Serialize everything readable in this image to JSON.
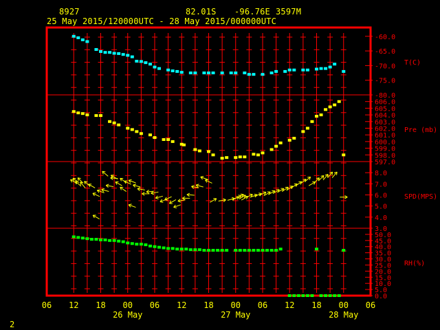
{
  "header": {
    "station": "8927",
    "lat": "82.01S",
    "lon": "-96.76E",
    "elev": "3597M",
    "period": "25 May 2015/120000UTC - 28 May 2015/000000UTC",
    "footer_number": "2"
  },
  "colors": {
    "frame": "#ff0000",
    "temperature": "#00ffff",
    "pressure": "#ffff00",
    "wind": "#ffff00",
    "humidity": "#00ff00",
    "axis_text": "#ffff00",
    "panel_labels": "#ff0000"
  },
  "chart_data": {
    "type": "scatter",
    "x_unit": "hours after 25 May 06 UTC",
    "xlim": [
      0,
      72
    ],
    "x_tick_labels": [
      "06",
      "12",
      "18",
      "00",
      "06",
      "12",
      "18",
      "00",
      "06",
      "12",
      "18",
      "00",
      "06"
    ],
    "date_labels": [
      {
        "label": "26 May",
        "x": 18
      },
      {
        "label": "27 May",
        "x": 42
      },
      {
        "label": "28 May",
        "x": 66
      }
    ],
    "panels": [
      {
        "key": "temp",
        "label": "T(C)",
        "ylim": [
          -80,
          -57
        ],
        "y_ticks": [
          -60,
          -65,
          -70,
          -75,
          -80
        ],
        "y_tick_labels": [
          "-60.0",
          "-65.0",
          "-70.0",
          "-75.0",
          "-80.0"
        ],
        "x": [
          6,
          7,
          8,
          9,
          11,
          12,
          13,
          14,
          15,
          16,
          17,
          18,
          19,
          20,
          21,
          22,
          23,
          24,
          25,
          27,
          28,
          29,
          30,
          32,
          33,
          35,
          36,
          37,
          39,
          41,
          42,
          44,
          45,
          46,
          48,
          50,
          51,
          53,
          54,
          55,
          57,
          58,
          60,
          61,
          62,
          63,
          64,
          66
        ],
        "values": [
          -60.0,
          -60.5,
          -61.2,
          -61.8,
          -64.5,
          -65.2,
          -65.5,
          -65.5,
          -65.8,
          -65.9,
          -66.2,
          -66.5,
          -67.0,
          -68.5,
          -68.6,
          -69.0,
          -69.5,
          -70.5,
          -71.0,
          -71.5,
          -71.8,
          -72.0,
          -72.3,
          -72.5,
          -72.5,
          -72.5,
          -72.5,
          -72.5,
          -72.5,
          -72.5,
          -72.5,
          -72.5,
          -73.0,
          -73.0,
          -73.0,
          -72.5,
          -72.0,
          -72.0,
          -71.5,
          -71.5,
          -71.5,
          -71.5,
          -71.2,
          -71.0,
          -71.0,
          -70.5,
          -69.5,
          -72.0
        ]
      },
      {
        "key": "pres",
        "label": "Pre (mb)",
        "ylim": [
          597,
          607
        ],
        "y_ticks": [
          606,
          605,
          604,
          603,
          602,
          601,
          600,
          599,
          598,
          597
        ],
        "y_tick_labels": [
          "606.0",
          "605.0",
          "604.0",
          "603.0",
          "602.0",
          "601.0",
          "600.0",
          "599.0",
          "598.0",
          "597.0"
        ],
        "x": [
          6,
          7,
          8,
          9,
          11,
          12,
          14,
          15,
          16,
          18,
          19,
          20,
          21,
          23,
          24,
          26,
          27,
          28,
          30,
          30.5,
          33,
          34,
          36,
          37,
          39,
          40,
          42,
          43,
          44,
          46,
          47,
          48,
          50,
          51,
          52,
          54,
          55,
          57,
          58,
          59,
          60,
          61,
          62,
          63,
          64,
          65,
          66
        ],
        "values": [
          604.5,
          604.3,
          604.2,
          604.0,
          603.9,
          603.9,
          603.0,
          602.8,
          602.5,
          602.0,
          601.8,
          601.5,
          601.2,
          601.0,
          600.6,
          600.3,
          600.3,
          600.0,
          599.6,
          599.5,
          598.8,
          598.6,
          598.5,
          598.0,
          597.5,
          597.6,
          597.6,
          597.7,
          597.7,
          598.1,
          598.0,
          598.3,
          598.8,
          599.3,
          599.8,
          600.2,
          600.5,
          601.5,
          602.0,
          603.0,
          603.8,
          604.0,
          604.8,
          605.2,
          605.5,
          606.0,
          598.0
        ]
      },
      {
        "key": "wind",
        "label": "SPD(MPS)",
        "ylim": [
          3,
          9
        ],
        "y_ticks": [
          8,
          7,
          6,
          5,
          4,
          3
        ],
        "y_tick_labels": [
          "8.0",
          "7.0",
          "6.0",
          "5.0",
          "4.0",
          "3.0"
        ],
        "x": [
          6,
          6.5,
          7,
          7.5,
          8,
          9,
          10,
          11,
          12,
          13,
          14,
          15,
          16,
          17,
          18,
          19,
          20,
          21,
          22,
          23,
          24,
          25,
          26,
          27,
          28,
          29,
          30,
          31,
          32,
          33,
          34,
          35,
          36,
          37,
          39,
          41,
          42,
          42.5,
          43,
          43.5,
          44,
          45,
          46,
          47,
          48,
          49,
          50,
          51,
          52,
          53,
          54,
          55,
          56,
          57,
          58,
          59,
          60,
          61,
          62,
          63,
          64,
          66,
          11,
          13,
          15,
          17,
          19
        ],
        "values": [
          7.2,
          7.3,
          7.0,
          7.3,
          6.9,
          7.0,
          6.8,
          6.0,
          6.3,
          6.4,
          6.8,
          7.5,
          7.0,
          6.5,
          7.1,
          7.2,
          6.8,
          6.5,
          6.1,
          6.3,
          6.2,
          5.8,
          5.5,
          5.7,
          5.4,
          5.0,
          5.5,
          5.7,
          6.0,
          6.7,
          6.8,
          7.5,
          7.2,
          5.5,
          5.5,
          5.6,
          5.7,
          5.8,
          5.9,
          5.8,
          5.7,
          5.9,
          5.9,
          6.0,
          6.1,
          6.1,
          6.2,
          6.3,
          6.4,
          6.5,
          6.6,
          6.8,
          7.0,
          7.2,
          7.4,
          7.0,
          7.3,
          7.5,
          7.6,
          7.8,
          7.8,
          5.8,
          4.0,
          7.9,
          7.6,
          7.3,
          5.0
        ],
        "directions_deg": [
          300,
          305,
          310,
          315,
          320,
          310,
          300,
          295,
          290,
          285,
          280,
          275,
          300,
          305,
          295,
          290,
          285,
          280,
          270,
          265,
          260,
          255,
          250,
          245,
          240,
          250,
          260,
          270,
          275,
          280,
          285,
          290,
          295,
          60,
          80,
          75,
          70,
          65,
          65,
          60,
          60,
          65,
          70,
          70,
          65,
          60,
          60,
          60,
          60,
          55,
          55,
          55,
          55,
          50,
          50,
          60,
          45,
          45,
          40,
          40,
          40,
          90,
          300,
          310,
          300,
          305,
          290
        ]
      },
      {
        "key": "rh",
        "label": "RH(%)",
        "ylim": [
          0,
          55
        ],
        "y_ticks": [
          50,
          45,
          40,
          35,
          30,
          25,
          20,
          15,
          10,
          5,
          0
        ],
        "y_tick_labels": [
          "50.0",
          "45.0",
          "40.0",
          "35.0",
          "30.0",
          "25.0",
          "20.0",
          "15.0",
          "10.0",
          "5.0",
          "0.0"
        ],
        "x": [
          6,
          7,
          8,
          9,
          10,
          11,
          12,
          13,
          14,
          15,
          16,
          17,
          18,
          19,
          20,
          21,
          22,
          23,
          24,
          25,
          26,
          27,
          28,
          29,
          30,
          31,
          32,
          33,
          34,
          35,
          36,
          37,
          38,
          39,
          40,
          42,
          43,
          44,
          45,
          46,
          47,
          48,
          49,
          50,
          51,
          52,
          54,
          55,
          56,
          57,
          58,
          59,
          60,
          61,
          62,
          63,
          64,
          65,
          66
        ],
        "values": [
          48,
          47.5,
          47,
          46.5,
          46,
          46,
          45.5,
          45.5,
          45,
          45,
          44.5,
          44,
          43,
          42.5,
          42,
          42,
          41.5,
          40.5,
          40,
          39.5,
          39,
          38.5,
          38.5,
          38,
          38,
          38,
          37.5,
          37.5,
          37.5,
          37,
          37,
          37,
          37,
          37,
          37,
          37,
          37,
          37,
          37,
          37,
          37,
          37,
          37,
          37,
          37,
          38,
          0,
          0,
          0,
          0,
          0,
          0,
          38,
          0,
          0,
          0,
          0,
          0,
          37
        ]
      }
    ]
  }
}
